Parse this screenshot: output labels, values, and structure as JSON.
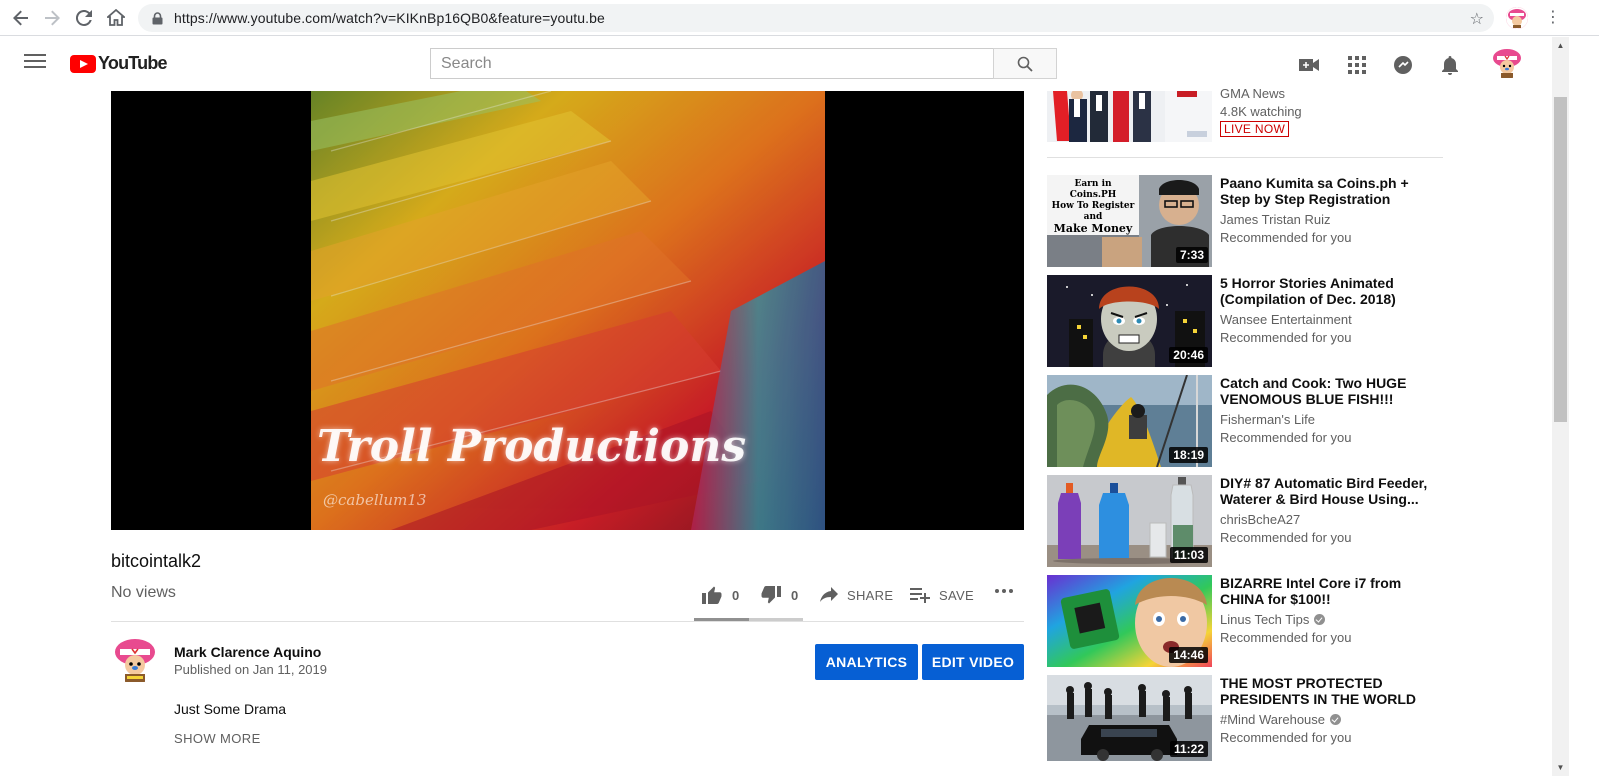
{
  "browser": {
    "url": "https://www.youtube.com/watch?v=KIKnBp16QB0&feature=youtu.be"
  },
  "header": {
    "logo_text": "YouTube",
    "search_placeholder": "Search"
  },
  "video": {
    "watermark_text": "Troll Productions",
    "watermark_handle": "@cabellum13",
    "title": "bitcointalk2",
    "views": "No views",
    "likes": "0",
    "dislikes": "0",
    "share_label": "SHARE",
    "save_label": "SAVE",
    "like_ratio": 0.5
  },
  "owner": {
    "name": "Mark Clarence Aquino",
    "published": "Published on Jan 11, 2019",
    "analytics_label": "ANALYTICS",
    "edit_label": "EDIT VIDEO",
    "description": "Just Some Drama",
    "show_more": "SHOW MORE"
  },
  "live_item": {
    "channel": "GMA News",
    "watching": "4.8K watching",
    "badge": "LIVE NOW"
  },
  "recommendations": [
    {
      "title": "Paano Kumita sa Coins.ph + Step by Step Registration and...",
      "channel": "James Tristan Ruiz",
      "verified": false,
      "meta": "Recommended for you",
      "duration": "7:33",
      "thumb_text": [
        "Earn in Coins.PH",
        "How To Register",
        "and",
        "Make Money"
      ]
    },
    {
      "title": "5 Horror Stories Animated (Compilation of Dec. 2018)",
      "channel": "Wansee Entertainment",
      "verified": false,
      "meta": "Recommended for you",
      "duration": "20:46"
    },
    {
      "title": "Catch and Cook: Two HUGE VENOMOUS BLUE FISH!!! Let's...",
      "channel": "Fisherman's Life",
      "verified": false,
      "meta": "Recommended for you",
      "duration": "18:19"
    },
    {
      "title": "DIY# 87 Automatic Bird Feeder, Waterer & Bird House Using...",
      "channel": "chrisBcheA27",
      "verified": false,
      "meta": "Recommended for you",
      "duration": "11:03"
    },
    {
      "title": "BIZARRE Intel Core i7 from CHINA for $100!!",
      "channel": "Linus Tech Tips",
      "verified": true,
      "meta": "Recommended for you",
      "duration": "14:46"
    },
    {
      "title": "THE MOST PROTECTED PRESIDENTS IN THE WORLD",
      "channel": "#Mind Warehouse",
      "verified": true,
      "meta": "Recommended for you",
      "duration": "11:22"
    }
  ],
  "icons": {
    "back": "arrow-left-icon",
    "forward": "arrow-right-icon",
    "reload": "reload-icon",
    "home": "home-icon",
    "lock": "lock-icon",
    "star": "star-icon",
    "menu": "hamburger-icon",
    "search": "search-icon",
    "upload": "video-camera-icon",
    "apps": "apps-grid-icon",
    "messages": "chat-icon",
    "notifications": "bell-icon"
  },
  "colors": {
    "brand_red": "#ff0000",
    "action_blue": "#065fd4",
    "live_red": "#cc0000"
  }
}
